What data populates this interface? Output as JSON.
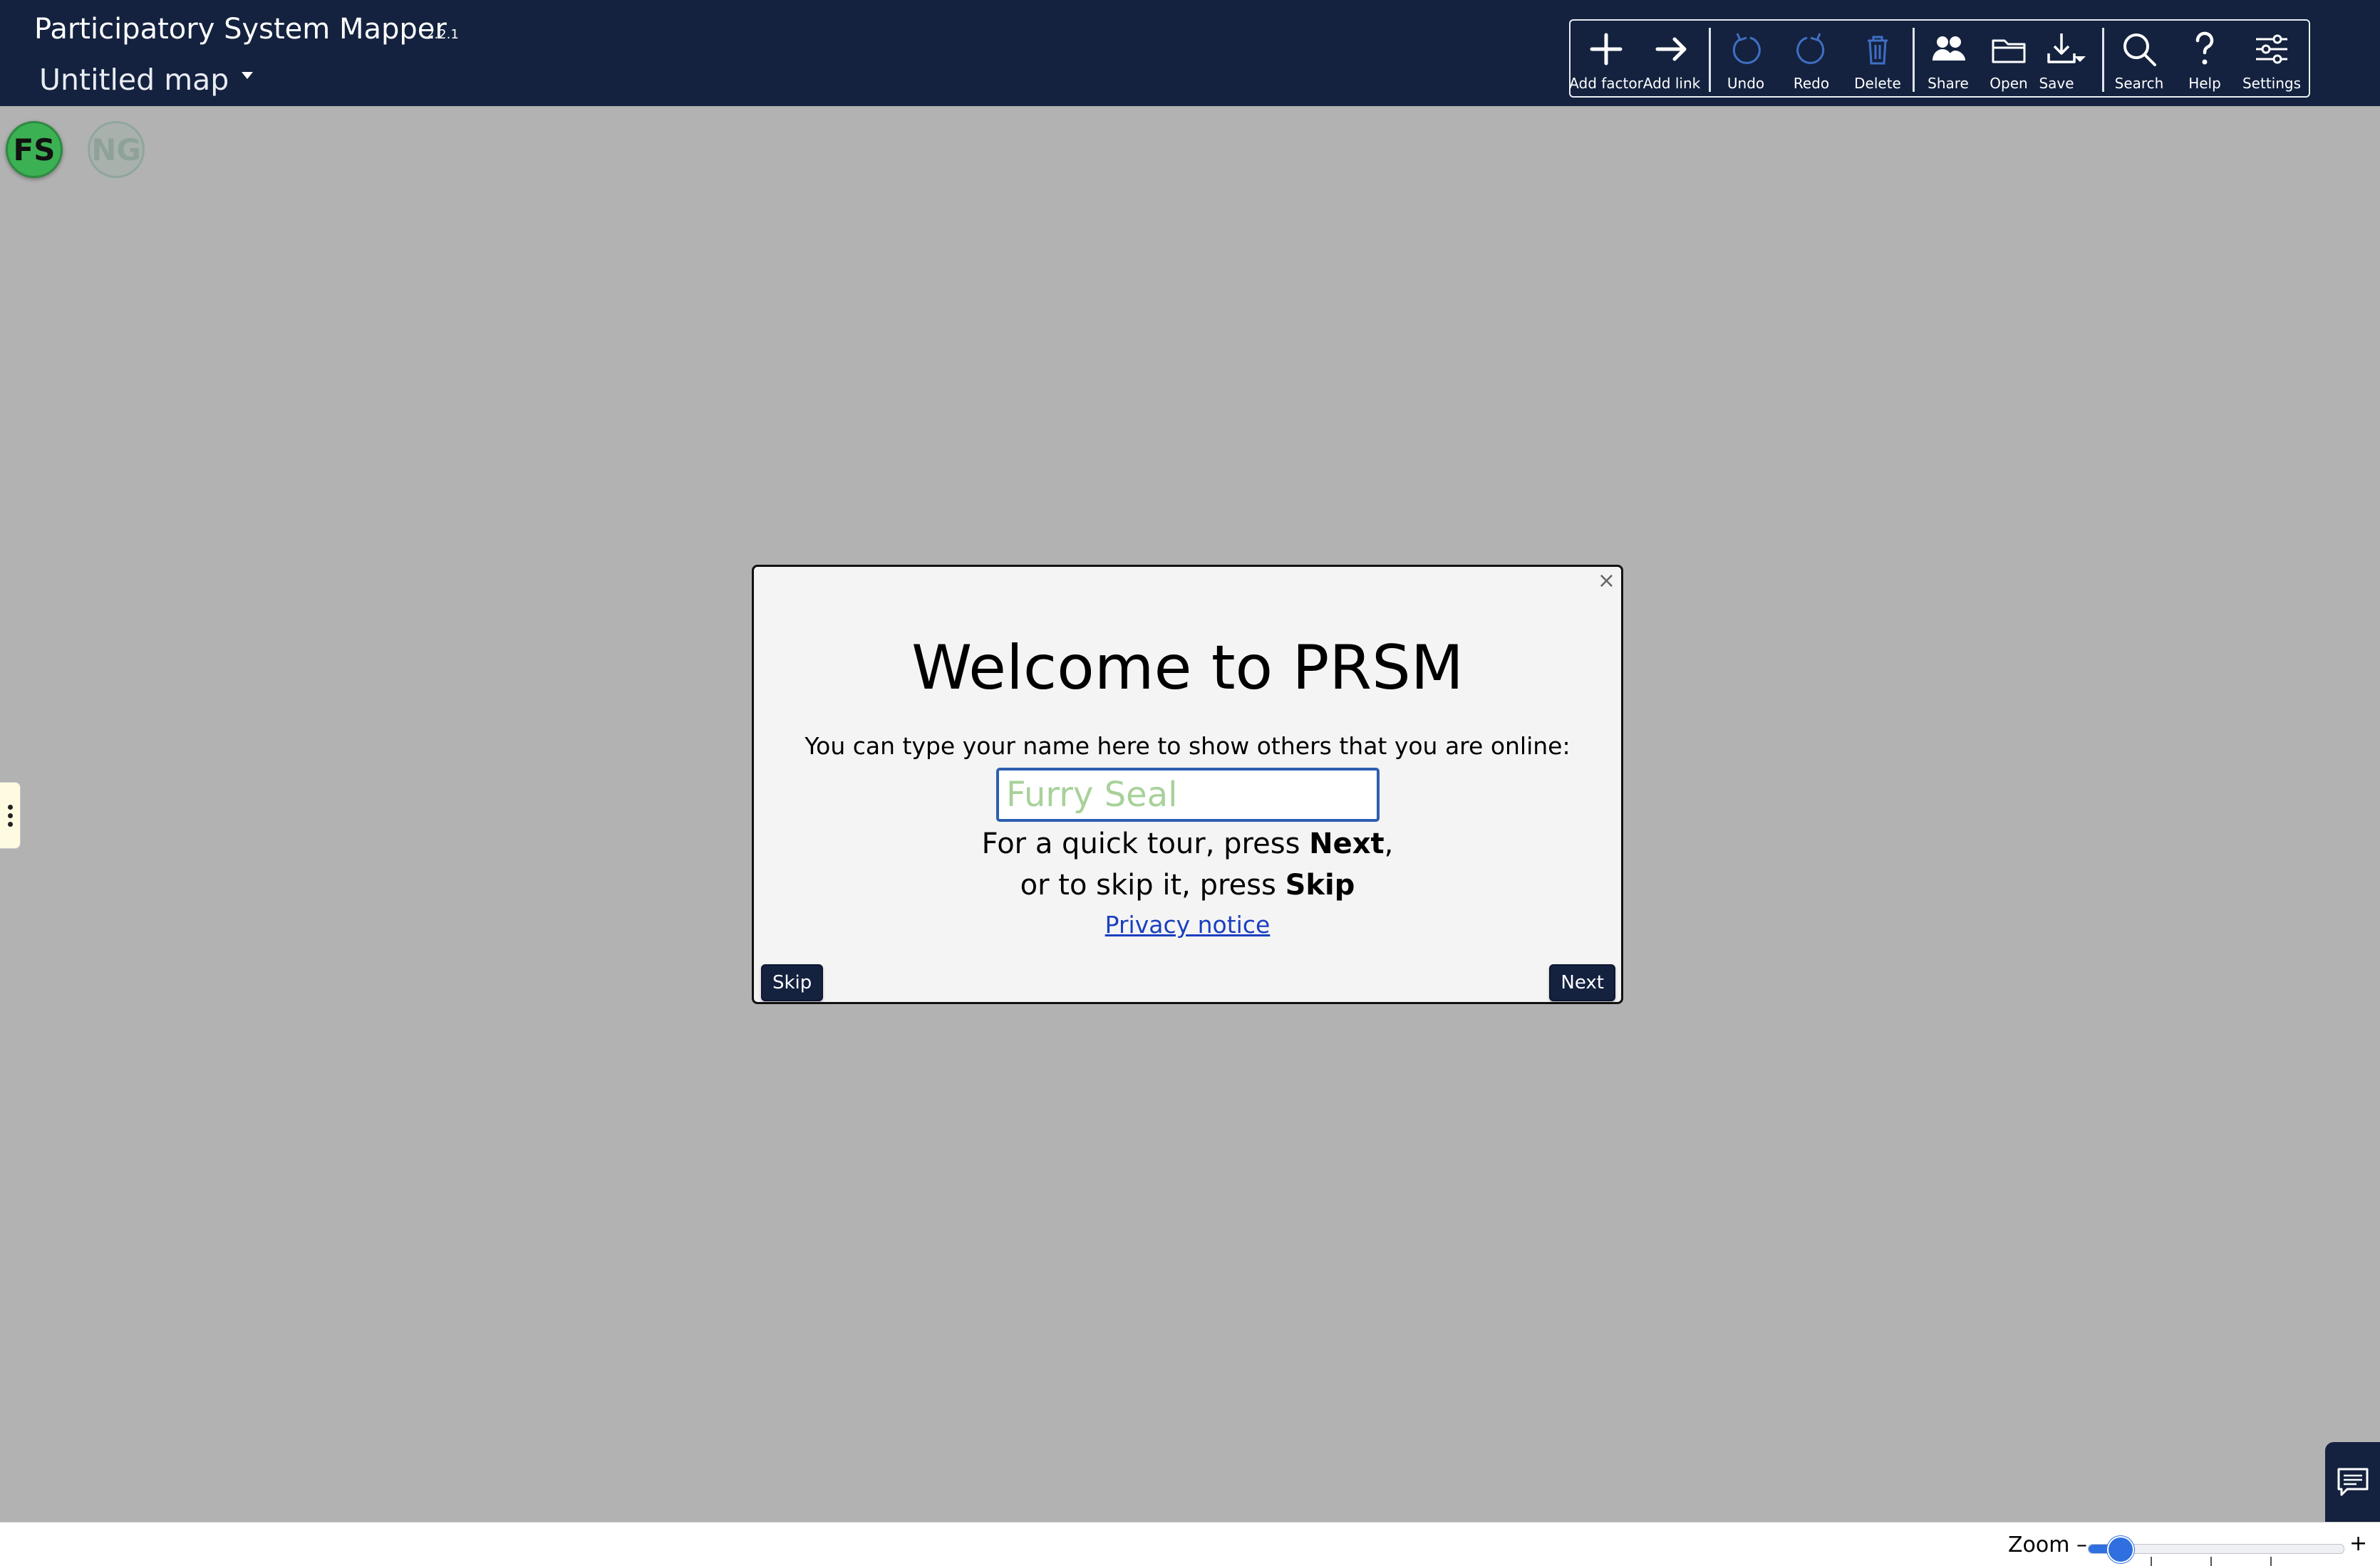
{
  "header": {
    "app_title": "Participatory System Mapper",
    "version": "2.2.1",
    "map_title": "Untitled map"
  },
  "toolbar": {
    "add_factor": "Add factor",
    "add_link": "Add link",
    "undo": "Undo",
    "redo": "Redo",
    "delete": "Delete",
    "share": "Share",
    "open": "Open",
    "save": "Save",
    "search": "Search",
    "help": "Help",
    "settings": "Settings"
  },
  "avatars": {
    "self_initials": "FS",
    "other_initials": "NG"
  },
  "modal": {
    "heading": "Welcome to PRSM",
    "prompt": "You can type your name here to show others that you are online:",
    "name_placeholder": "Furry Seal",
    "tour_line1_prefix": "For a quick tour, press ",
    "tour_line1_bold": "Next",
    "tour_line1_suffix": ",",
    "tour_line2_prefix": "or to skip it, press ",
    "tour_line2_bold": "Skip",
    "privacy_link": "Privacy notice",
    "skip_button": "Skip",
    "next_button": "Next",
    "close_symbol": "×"
  },
  "zoom": {
    "label": "Zoom –",
    "plus": "+",
    "level_fraction": 0.12
  },
  "colors": {
    "navbar": "#14223f",
    "canvas": "#b2b2b2",
    "accent": "#2f6fe0"
  }
}
